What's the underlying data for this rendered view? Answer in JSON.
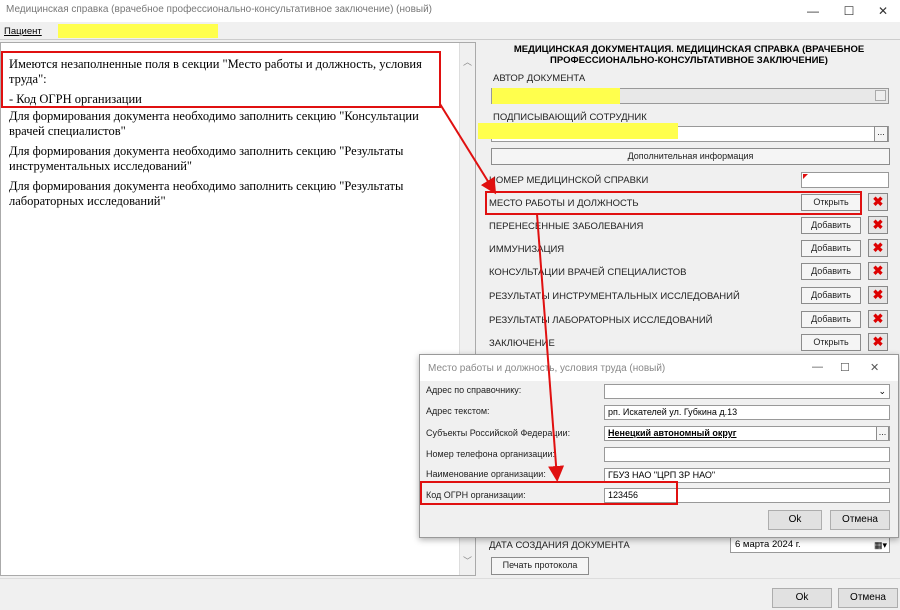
{
  "window": {
    "title": "Медицинская справка (врачебное профессионально-консультативное заключение) (новый)",
    "minimize": "—",
    "maximize": "☐",
    "close": "✕"
  },
  "patient_bar": {
    "label": "Пациент"
  },
  "messages": [
    "Имеются незаполненные поля в секции \"Место работы и должность, условия труда\":",
    "- Код ОГРН организации",
    "Для формирования документа необходимо заполнить секцию \"Консультации врачей специалистов\"",
    "Для формирования документа необходимо заполнить секцию \"Результаты инструментальных исследований\"",
    "Для формирования документа необходимо заполнить секцию \"Результаты лабораторных исследований\""
  ],
  "doc": {
    "header": "МЕДИЦИНСКАЯ ДОКУМЕНТАЦИЯ. МЕДИЦИНСКАЯ СПРАВКА (ВРАЧЕБНОЕ ПРОФЕССИОНАЛЬНО-КОНСУЛЬТАТИВНОЕ ЗАКЛЮЧЕНИЕ)",
    "author_label": "АВТОР ДОКУМЕНТА",
    "signer_label": "ПОДПИСЫВАЮЩИЙ СОТРУДНИК",
    "extra_info_button": "Дополнительная информация",
    "cert_number_label": "НОМЕР МЕДИЦИНСКОЙ СПРАВКИ",
    "ellipsis": "...",
    "sections": [
      {
        "label": "МЕСТО РАБОТЫ И ДОЛЖНОСТЬ",
        "button": "Открыть"
      },
      {
        "label": "ПЕРЕНЕСЕННЫЕ ЗАБОЛЕВАНИЯ",
        "button": "Добавить"
      },
      {
        "label": "ИММУНИЗАЦИЯ",
        "button": "Добавить"
      },
      {
        "label": "КОНСУЛЬТАЦИИ ВРАЧЕЙ СПЕЦИАЛИСТОВ",
        "button": "Добавить"
      },
      {
        "label": "РЕЗУЛЬТАТЫ ИНСТРУМЕНТАЛЬНЫХ ИССЛЕДОВАНИЙ",
        "button": "Добавить"
      },
      {
        "label": "РЕЗУЛЬТАТЫ ЛАБОРАТОРНЫХ ИССЛЕДОВАНИЙ",
        "button": "Добавить"
      },
      {
        "label": "ЗАКЛЮЧЕНИЕ",
        "button": "Открыть"
      }
    ],
    "delete_glyph": "✖",
    "created_label": "ДАТА СОЗДАНИЯ ДОКУМЕНТА",
    "created_value": "6   марта   2024 г.",
    "print_button": "Печать протокола"
  },
  "dialog": {
    "title": "Место работы и должность, условия труда (новый)",
    "fields": [
      {
        "label": "Адрес по справочнику:",
        "value": ""
      },
      {
        "label": "Адрес текстом:",
        "value": "рп. Искателей ул. Губкина д.13"
      },
      {
        "label": "Субъекты Российской Федерации:",
        "value": "Ненецкий автономный округ"
      },
      {
        "label": "Номер телефона организации:",
        "value": ""
      },
      {
        "label": "Наименование организации:",
        "value": "ГБУЗ НАО \"ЦРП ЗР НАО\""
      },
      {
        "label": "Код ОГРН организации:",
        "value": "123456"
      }
    ],
    "ok": "Ok",
    "cancel": "Отмена"
  },
  "footer": {
    "ok": "Ok",
    "cancel": "Отмена"
  },
  "colors": {
    "highlight": "#ffff4d",
    "annotation_red": "#e01010"
  }
}
